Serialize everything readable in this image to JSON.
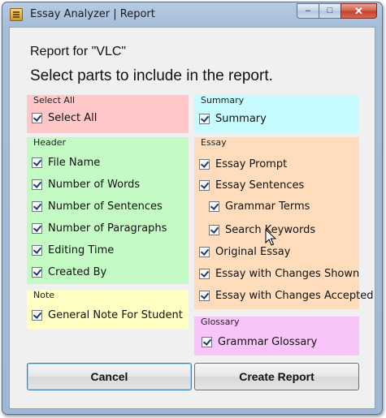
{
  "window": {
    "title": "Essay Analyzer | Report"
  },
  "caption": {
    "minimize": "–",
    "maximize": "□",
    "close": "✕"
  },
  "report_for": "Report for \"VLC\"",
  "instruction": "Select parts to include in the report.",
  "colors": {
    "select_all": "#ffc7c7",
    "summary": "#c7fcff",
    "header": "#c4fbc4",
    "note": "#ffffc4",
    "essay": "#ffdcbc",
    "glossary": "#f9c4f9"
  },
  "groups": {
    "select_all": {
      "title": "Select All",
      "items": [
        {
          "label": "Select All",
          "checked": true
        }
      ]
    },
    "summary": {
      "title": "Summary",
      "items": [
        {
          "label": "Summary",
          "checked": true
        }
      ]
    },
    "header": {
      "title": "Header",
      "items": [
        {
          "label": "File Name",
          "checked": true
        },
        {
          "label": "Number of Words",
          "checked": true
        },
        {
          "label": "Number of Sentences",
          "checked": true
        },
        {
          "label": "Number of Paragraphs",
          "checked": true
        },
        {
          "label": "Editing Time",
          "checked": true
        },
        {
          "label": "Created By",
          "checked": true
        }
      ]
    },
    "note": {
      "title": "Note",
      "items": [
        {
          "label": "General Note For Student",
          "checked": true
        }
      ]
    },
    "essay": {
      "title": "Essay",
      "items": [
        {
          "label": "Essay Prompt",
          "checked": true
        },
        {
          "label": "Essay Sentences",
          "checked": true
        },
        {
          "label": "Grammar Terms",
          "checked": true
        },
        {
          "label": "Search Keywords",
          "checked": true
        },
        {
          "label": "Original Essay",
          "checked": true
        },
        {
          "label": "Essay with Changes Shown",
          "checked": true
        },
        {
          "label": "Essay with Changes Accepted",
          "checked": true
        }
      ]
    },
    "glossary": {
      "title": "Glossary",
      "items": [
        {
          "label": "Grammar Glossary",
          "checked": true
        }
      ]
    }
  },
  "buttons": {
    "cancel": "Cancel",
    "create": "Create Report"
  }
}
